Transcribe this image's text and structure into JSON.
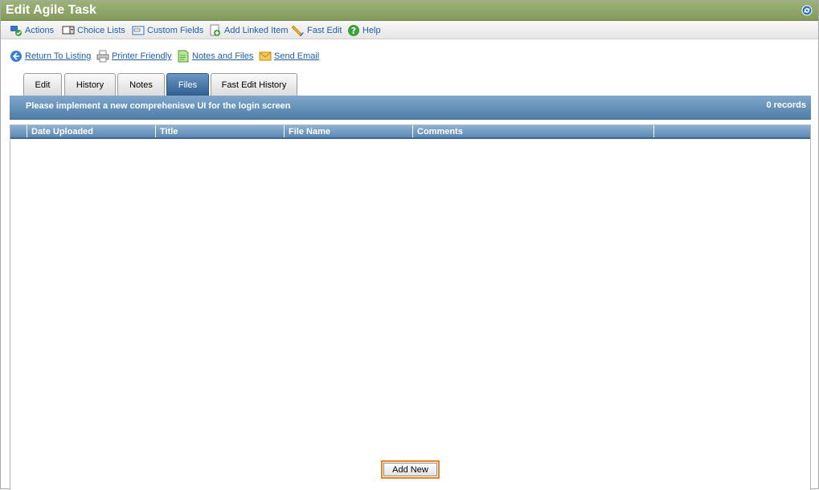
{
  "window": {
    "title": "Edit Agile Task",
    "refresh_icon": "refresh-icon"
  },
  "toolbar": {
    "items": [
      {
        "label": "Actions",
        "icon": "actions-icon"
      },
      {
        "label": "Choice Lists",
        "icon": "choice-lists-icon"
      },
      {
        "label": "Custom Fields",
        "icon": "custom-fields-icon"
      },
      {
        "label": "Add Linked Item",
        "icon": "add-linked-item-icon"
      },
      {
        "label": "Fast Edit",
        "icon": "fast-edit-icon"
      },
      {
        "label": "Help",
        "icon": "help-icon"
      }
    ]
  },
  "links": {
    "items": [
      {
        "label": "Return To Listing",
        "icon": "back-arrow-icon"
      },
      {
        "label": "Printer Friendly",
        "icon": "printer-icon"
      },
      {
        "label": "Notes and Files",
        "icon": "notes-icon"
      },
      {
        "label": "Send Email",
        "icon": "email-icon"
      }
    ]
  },
  "tabs": [
    {
      "label": "Edit",
      "active": false
    },
    {
      "label": "History",
      "active": false
    },
    {
      "label": "Notes",
      "active": false
    },
    {
      "label": "Files",
      "active": true
    },
    {
      "label": "Fast Edit History",
      "active": false
    }
  ],
  "task": {
    "description": "Please implement a new comprehenisve UI for the login screen",
    "record_count": "0 records"
  },
  "grid": {
    "columns": [
      "",
      "Date Uploaded",
      "Title",
      "File Name",
      "Comments",
      ""
    ]
  },
  "buttons": {
    "add_new": "Add New"
  },
  "colors": {
    "title_bar": "#8ba564",
    "header_bar": "#5b88b3",
    "active_tab": "#2f5e92",
    "link": "#1f5fa6",
    "button_highlight": "#f0821d"
  }
}
